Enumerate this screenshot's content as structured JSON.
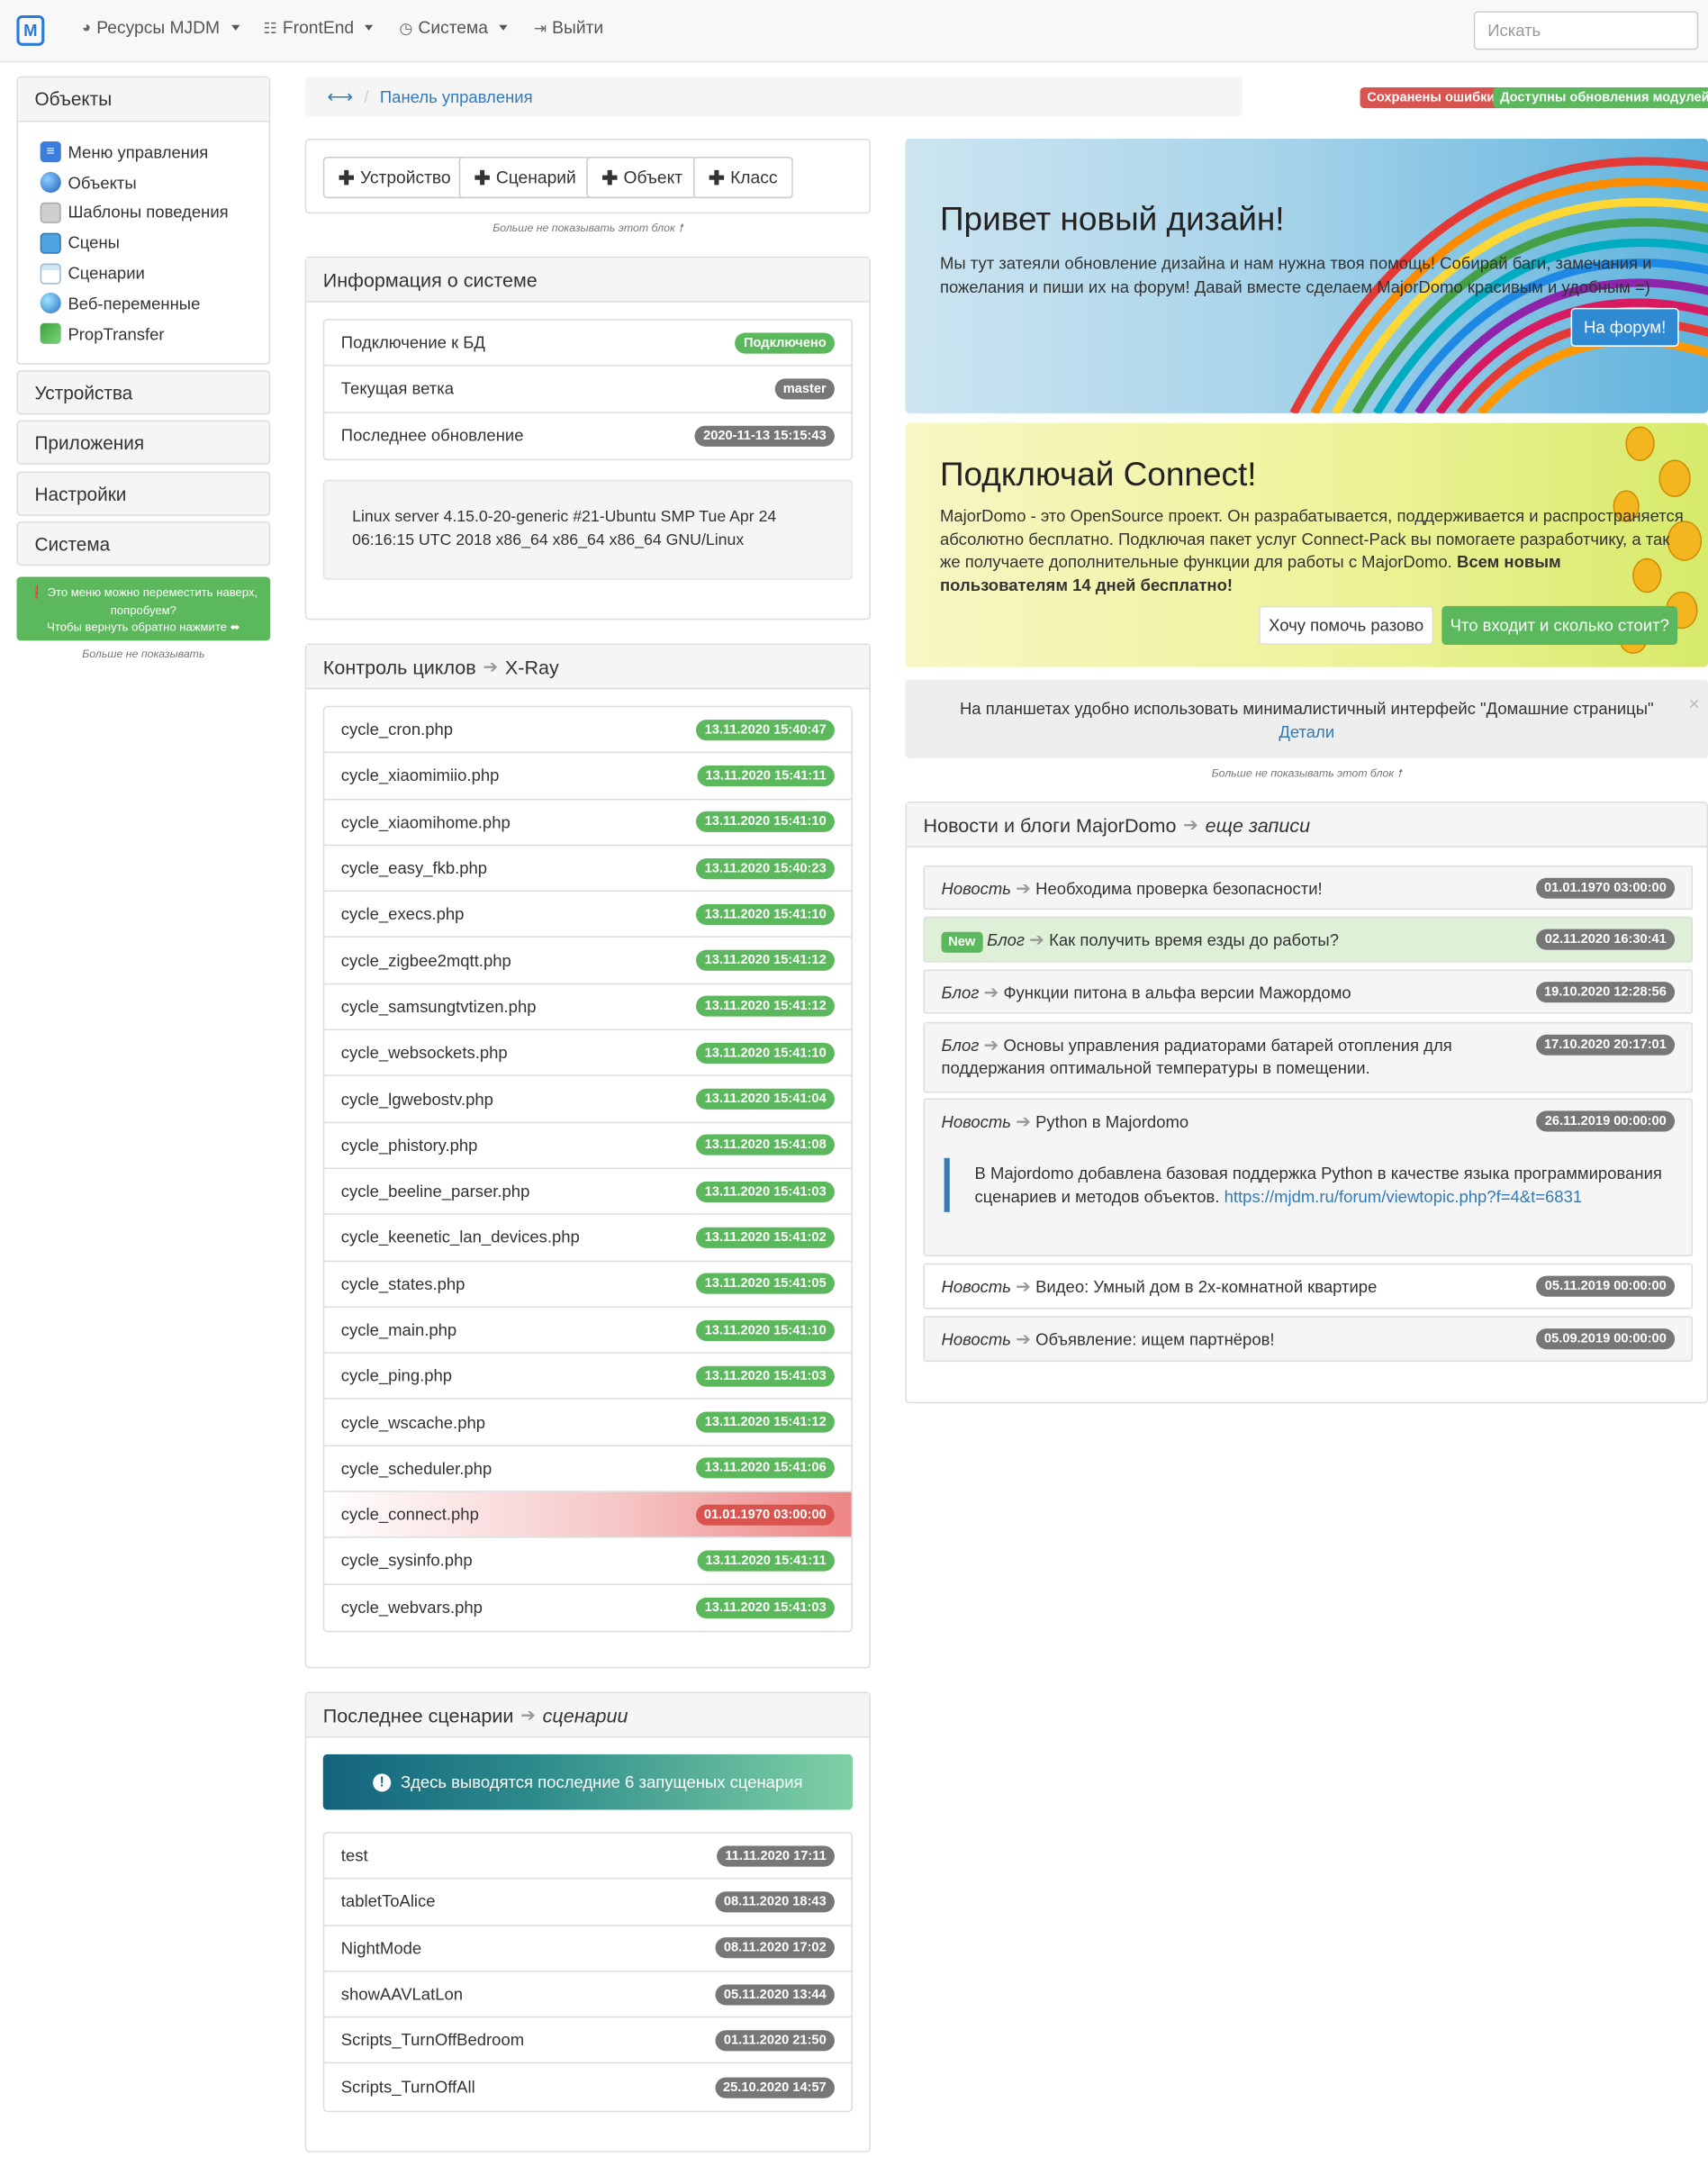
{
  "navbar": {
    "brand_letter": "M",
    "items": [
      {
        "label": "Ресурсы MJDM",
        "icon": "globe-icon"
      },
      {
        "label": "FrontEnd",
        "icon": "list-icon"
      },
      {
        "label": "Система",
        "icon": "gauge-icon"
      },
      {
        "label": "Выйти",
        "icon": "logout-icon"
      }
    ],
    "search_placeholder": "Искать"
  },
  "sidebar": {
    "objects_title": "Объекты",
    "items": [
      {
        "label": "Меню управления",
        "icon": "menu-icon"
      },
      {
        "label": "Объекты",
        "icon": "globe-icon"
      },
      {
        "label": "Шаблоны поведения",
        "icon": "template-icon"
      },
      {
        "label": "Сцены",
        "icon": "scenes-icon"
      },
      {
        "label": "Сценарии",
        "icon": "scripts-icon"
      },
      {
        "label": "Веб-переменные",
        "icon": "web-globe-icon"
      },
      {
        "label": "PropTransfer",
        "icon": "transfer-icon"
      }
    ],
    "sections": [
      "Устройства",
      "Приложения",
      "Настройки",
      "Система"
    ],
    "tip_line1": "Это меню можно переместить наверх, попробуем?",
    "tip_line2": "Чтобы вернуть обратно нажмите ⬌",
    "tip_dismiss": "Больше не показывать"
  },
  "breadcrumb": {
    "current": "Панель управления"
  },
  "badges": {
    "errors": "Сохранены ошибки",
    "updates": "Доступны обновления модулей"
  },
  "quick_add": {
    "buttons": [
      "Устройство",
      "Сценарий",
      "Объект",
      "Класс"
    ],
    "dismiss": "Больше не показывать этот блок"
  },
  "system_info": {
    "title": "Информация о системе",
    "rows": [
      {
        "label": "Подключение к БД",
        "value": "Подключено",
        "color": "#5cb85c"
      },
      {
        "label": "Текущая ветка",
        "value": "master",
        "color": "#777777"
      },
      {
        "label": "Последнее обновление",
        "value": "2020-11-13 15:15:43",
        "color": "#777777"
      }
    ],
    "uname": "Linux server 4.15.0-20-generic #21-Ubuntu SMP Tue Apr 24 06:16:15 UTC 2018 x86_64 x86_64 x86_64 GNU/Linux"
  },
  "cycles": {
    "title": "Контроль циклов",
    "link": "X-Ray",
    "rows": [
      {
        "name": "cycle_cron.php",
        "time": "13.11.2020 15:40:47",
        "ok": true
      },
      {
        "name": "cycle_xiaomimiio.php",
        "time": "13.11.2020 15:41:11",
        "ok": true
      },
      {
        "name": "cycle_xiaomihome.php",
        "time": "13.11.2020 15:41:10",
        "ok": true
      },
      {
        "name": "cycle_easy_fkb.php",
        "time": "13.11.2020 15:40:23",
        "ok": true
      },
      {
        "name": "cycle_execs.php",
        "time": "13.11.2020 15:41:10",
        "ok": true
      },
      {
        "name": "cycle_zigbee2mqtt.php",
        "time": "13.11.2020 15:41:12",
        "ok": true
      },
      {
        "name": "cycle_samsungtvtizen.php",
        "time": "13.11.2020 15:41:12",
        "ok": true
      },
      {
        "name": "cycle_websockets.php",
        "time": "13.11.2020 15:41:10",
        "ok": true
      },
      {
        "name": "cycle_lgwebostv.php",
        "time": "13.11.2020 15:41:04",
        "ok": true
      },
      {
        "name": "cycle_phistory.php",
        "time": "13.11.2020 15:41:08",
        "ok": true
      },
      {
        "name": "cycle_beeline_parser.php",
        "time": "13.11.2020 15:41:03",
        "ok": true
      },
      {
        "name": "cycle_keenetic_lan_devices.php",
        "time": "13.11.2020 15:41:02",
        "ok": true
      },
      {
        "name": "cycle_states.php",
        "time": "13.11.2020 15:41:05",
        "ok": true
      },
      {
        "name": "cycle_main.php",
        "time": "13.11.2020 15:41:10",
        "ok": true
      },
      {
        "name": "cycle_ping.php",
        "time": "13.11.2020 15:41:03",
        "ok": true
      },
      {
        "name": "cycle_wscache.php",
        "time": "13.11.2020 15:41:12",
        "ok": true
      },
      {
        "name": "cycle_scheduler.php",
        "time": "13.11.2020 15:41:06",
        "ok": true
      },
      {
        "name": "cycle_connect.php",
        "time": "01.01.1970 03:00:00",
        "ok": false
      },
      {
        "name": "cycle_sysinfo.php",
        "time": "13.11.2020 15:41:11",
        "ok": true
      },
      {
        "name": "cycle_webvars.php",
        "time": "13.11.2020 15:41:03",
        "ok": true
      }
    ]
  },
  "scripts": {
    "title": "Последнее сценарии",
    "link": "сценарии",
    "notice": "Здесь выводятся последние 6 запущеных сценария",
    "rows": [
      {
        "name": "test",
        "time": "11.11.2020 17:11"
      },
      {
        "name": "tabletToAlice",
        "time": "08.11.2020 18:43"
      },
      {
        "name": "NightMode",
        "time": "08.11.2020 17:02"
      },
      {
        "name": "showAAVLatLon",
        "time": "05.11.2020 13:44"
      },
      {
        "name": "Scripts_TurnOffBedroom",
        "time": "01.11.2020 21:50"
      },
      {
        "name": "Scripts_TurnOffAll",
        "time": "25.10.2020 14:57"
      }
    ]
  },
  "banner_design": {
    "title": "Привет новый дизайн!",
    "text": "Мы тут затеяли обновление дизайна и нам нужна твоя помощь! Собирай баги, замечания и пожелания и пиши их на форум! Давай вместе сделаем MajorDomo красивым и удобным =)",
    "button": "На форум!"
  },
  "banner_connect": {
    "title": "Подключай Connect!",
    "text": "MajorDomo - это OpenSource проект. Он разрабатывается, поддерживается и распространяется абсолютно бесплатно. Подключая пакет услуг Connect-Pack вы помогаете разработчику, а так же получаете дополнительные функции для работы с MajorDomo.",
    "bold": "Всем новым пользователям 14 дней бесплатно!",
    "btn_once": "Хочу помочь разово",
    "btn_info": "Что входит и сколько стоит?"
  },
  "tablet_tip": {
    "text": "На планшетах удобно использовать минималистичный интерфейс \"Домашние страницы\"",
    "link": "Детали",
    "dismiss": "Больше не показывать этот блок"
  },
  "news": {
    "title": "Новости и блоги MajorDomo",
    "link": "еще записи",
    "items": [
      {
        "type": "Новость",
        "title": "Необходима проверка безопасности!",
        "date": "01.01.1970 03:00:00"
      },
      {
        "badge": "New",
        "type": "Блог",
        "title": "Как получить время езды до работы?",
        "date": "02.11.2020 16:30:41"
      },
      {
        "type": "Блог",
        "title": "Функции питона в альфа версии Мажордомо",
        "date": "19.10.2020 12:28:56"
      },
      {
        "type": "Блог",
        "title": "Основы управления радиаторами батарей отопления для поддержания оптимальной температуры в помещении.",
        "date": "17.10.2020 20:17:01"
      },
      {
        "type": "Новость",
        "title": "Python в Majordomo",
        "date": "26.11.2019 00:00:00",
        "body": "В Majordomo добавлена базовая поддержка Python в качестве языка программирования сценариев и методов объектов.",
        "url": "https://mjdm.ru/forum/viewtopic.php?f=4&t=6831"
      },
      {
        "type": "Новость",
        "title": "Видео: Умный дом в 2х-комнатной квартире",
        "date": "05.11.2019 00:00:00"
      },
      {
        "type": "Новость",
        "title": "Объявление: ищем партнёров!",
        "date": "05.09.2019 00:00:00"
      }
    ]
  }
}
